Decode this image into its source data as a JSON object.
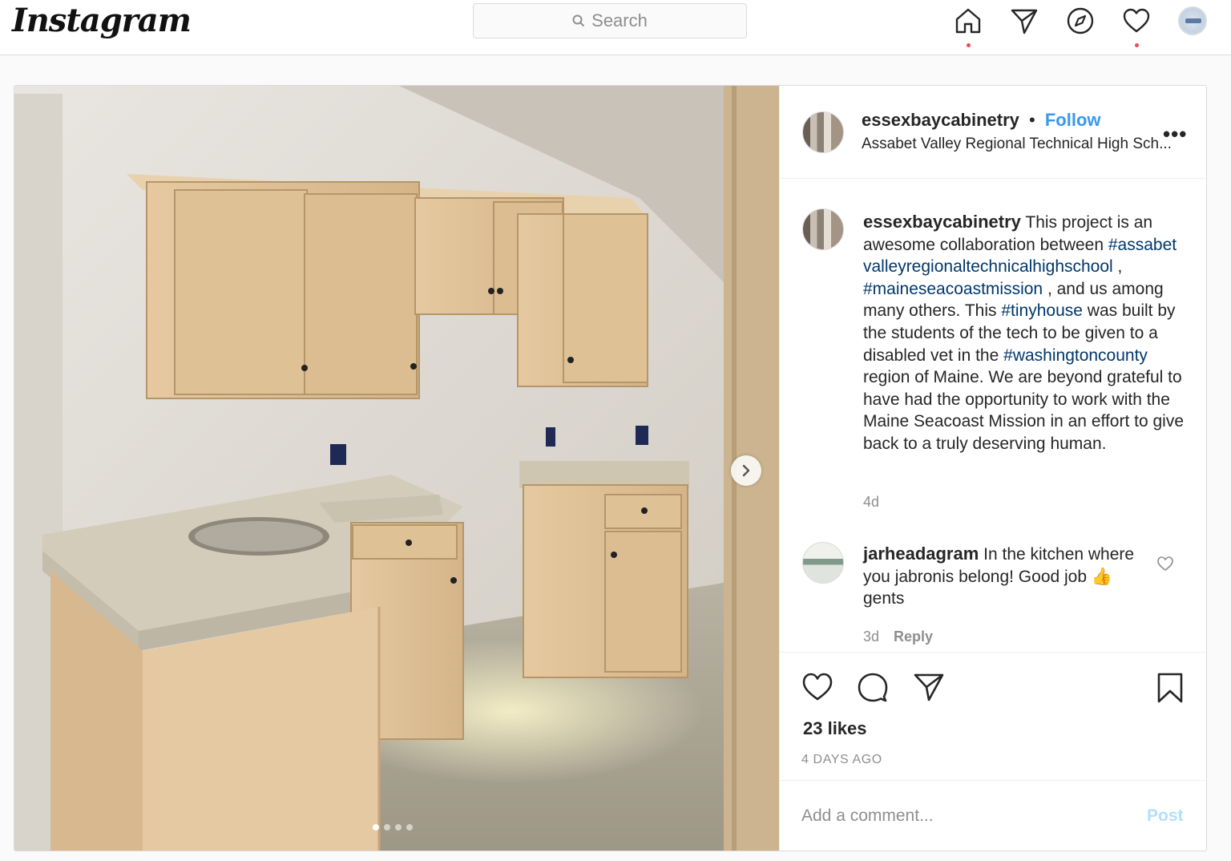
{
  "nav": {
    "logo": "Instagram",
    "search_placeholder": "Search"
  },
  "post": {
    "author": "essexbaycabinetry",
    "follow_separator": "•",
    "follow_label": "Follow",
    "location": "Assabet Valley Regional Technical High Sch...",
    "more_label": "•••",
    "photo_index": 1,
    "photo_count": 4
  },
  "caption": {
    "author": "essexbaycabinetry",
    "text1": "This project is an awesome collaboration between",
    "tag1": "#assabetvalleyregionaltechnicalhighschool",
    "text2": ",",
    "tag2": "#maineseacoastmission",
    "text3": ", and us among many others. This",
    "tag3": "#tinyhouse",
    "text4": "was built by the students of the tech to be given to a disabled vet in the",
    "tag4": "#washingtoncounty",
    "text5": "region of Maine. We are beyond grateful to have had the opportunity to work with the Maine Seacoast Mission in an effort to give back to a truly deserving human.",
    "time": "4d"
  },
  "comment": {
    "author": "jarheadagram",
    "text1": "In the kitchen where you jabronis belong! Good job",
    "emoji": "👍",
    "text2": "gents",
    "time": "3d",
    "reply_label": "Reply"
  },
  "stats": {
    "likes": "23 likes",
    "posted": "4 DAYS AGO"
  },
  "add_comment": {
    "placeholder": "Add a comment...",
    "post_label": "Post"
  },
  "colors": {
    "accent": "#3897f0",
    "hashtag": "#00376b",
    "notification": "#ed4956",
    "post_disabled": "#b2dffc"
  }
}
